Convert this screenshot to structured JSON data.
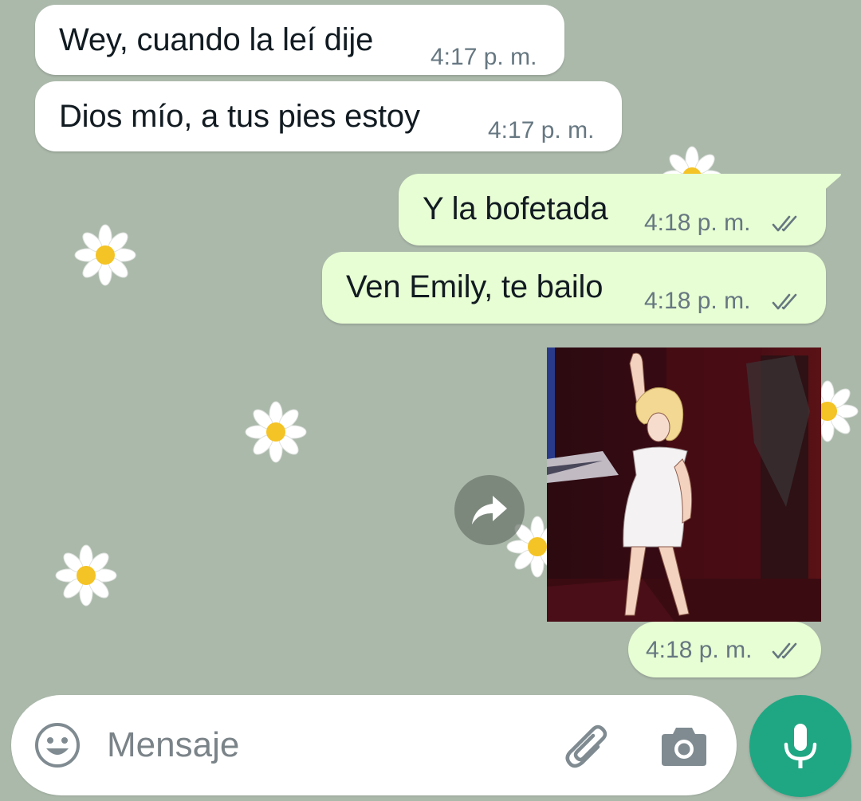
{
  "messages": [
    {
      "direction": "in",
      "text": "Wey, cuando la leí dije",
      "time": "4:17 p. m."
    },
    {
      "direction": "in",
      "text": "Dios mío, a tus pies estoy",
      "time": "4:17 p. m."
    },
    {
      "direction": "out",
      "text": "Y la bofetada",
      "time": "4:18 p. m.",
      "status": "read-ticks-icon"
    },
    {
      "direction": "out",
      "text": "Ven Emily, te bailo",
      "time": "4:18 p. m.",
      "status": "read-ticks-icon"
    },
    {
      "direction": "out",
      "type": "sticker",
      "sticker": "dancing-cartoon-woman",
      "time": "4:18 p. m.",
      "status": "read-ticks-icon"
    }
  ],
  "input": {
    "placeholder": "Mensaje",
    "emoji_icon": "emoji-icon",
    "attach_icon": "paperclip-icon",
    "camera_icon": "camera-icon",
    "mic_icon": "microphone-icon"
  },
  "colors": {
    "background": "#abb9ab",
    "incoming_bubble": "#ffffff",
    "outgoing_bubble": "#e7fdd3",
    "accent": "#1fa783",
    "meta_text": "#667781"
  }
}
